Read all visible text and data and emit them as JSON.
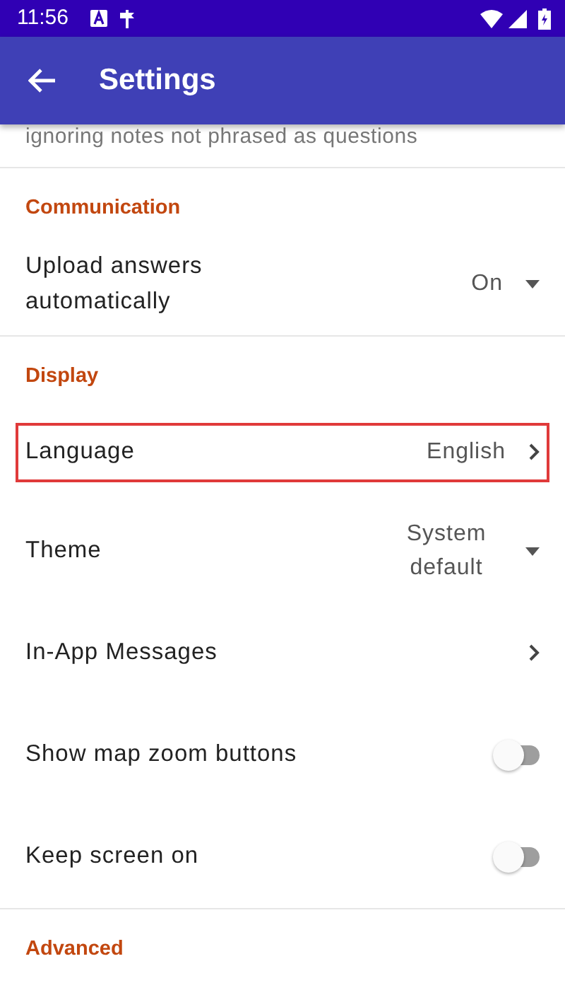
{
  "status_bar": {
    "time": "11:56"
  },
  "app_bar": {
    "title": "Settings"
  },
  "partial_text": "ignoring notes not phrased as questions",
  "sections": [
    {
      "title": "Communication",
      "items": [
        {
          "kind": "dropdown",
          "label": "Upload answers automatically",
          "value": "On"
        }
      ]
    },
    {
      "title": "Display",
      "items": [
        {
          "kind": "link",
          "label": "Language",
          "value": "English",
          "highlighted": true
        },
        {
          "kind": "dropdown",
          "label": "Theme",
          "value": "System default"
        },
        {
          "kind": "link",
          "label": "In-App Messages"
        },
        {
          "kind": "switch",
          "label": "Show map zoom buttons",
          "on": false
        },
        {
          "kind": "switch",
          "label": "Keep screen on",
          "on": false
        }
      ]
    },
    {
      "title": "Advanced"
    }
  ]
}
